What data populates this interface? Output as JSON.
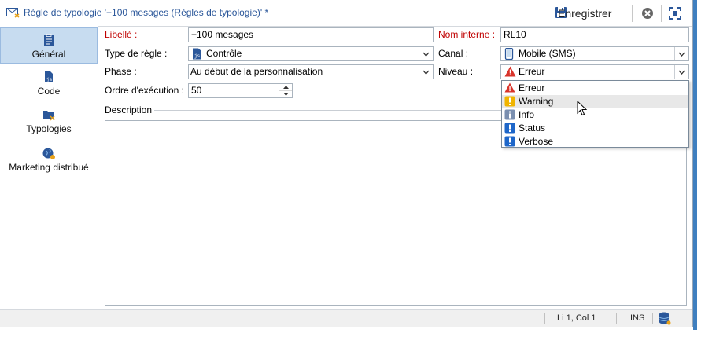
{
  "window": {
    "title": "Règle de typologie '+100 mesages (Règles de typologie)' *",
    "save_label": "Enregistrer"
  },
  "sidebar": {
    "items": [
      {
        "label": "Général",
        "icon": "clipboard-icon"
      },
      {
        "label": "Code",
        "icon": "code-file-icon"
      },
      {
        "label": "Typologies",
        "icon": "folder-icon"
      },
      {
        "label": "Marketing distribué",
        "icon": "globe-icon"
      }
    ]
  },
  "form": {
    "libelle_label": "Libellé :",
    "libelle_value": "+100 mesages",
    "nom_interne_label": "Nom interne :",
    "nom_interne_value": "RL10",
    "type_label": "Type de règle :",
    "type_value": "Contrôle",
    "canal_label": "Canal :",
    "canal_value": "Mobile (SMS)",
    "phase_label": "Phase :",
    "phase_value": "Au début de la personnalisation",
    "niveau_label": "Niveau :",
    "niveau_value": "Erreur",
    "ordre_label": "Ordre d'exécution :",
    "ordre_value": "50",
    "description_label": "Description"
  },
  "niveau_dropdown": {
    "options": [
      {
        "label": "Erreur",
        "icon": "error-triangle-icon"
      },
      {
        "label": "Warning",
        "icon": "warning-icon"
      },
      {
        "label": "Info",
        "icon": "info-icon"
      },
      {
        "label": "Status",
        "icon": "status-icon"
      },
      {
        "label": "Verbose",
        "icon": "verbose-icon"
      }
    ],
    "hovered": "Warning"
  },
  "statusbar": {
    "position": "Li 1, Col 1",
    "mode": "INS"
  },
  "colors": {
    "accent": "#2b579a",
    "required": "#c00000",
    "sidebar_active": "#c7dcf0",
    "error": "#d9332a",
    "warning": "#f0b400",
    "info": "#7a8fb0",
    "status": "#1d66c9"
  }
}
